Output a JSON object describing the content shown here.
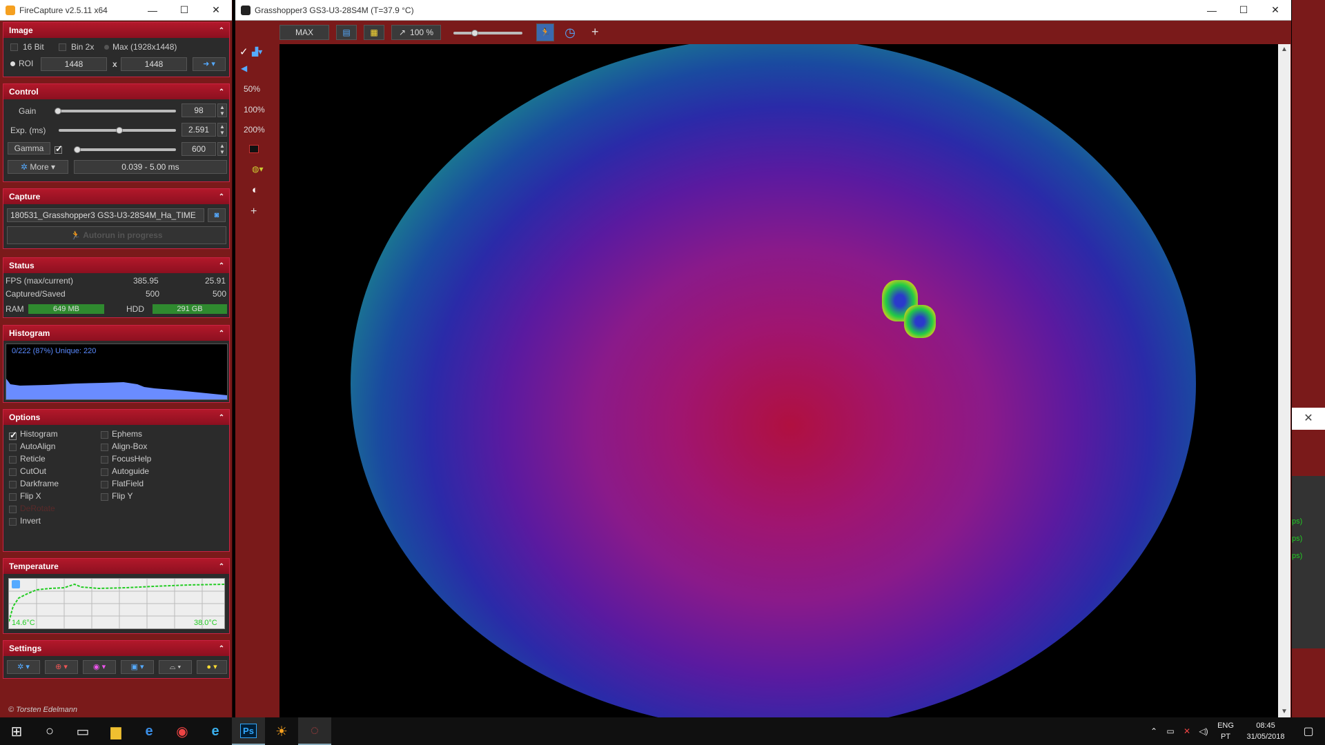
{
  "firecapture": {
    "title": "FireCapture v2.5.11  x64",
    "win_min": "—",
    "win_max": "☐",
    "win_close": "✕",
    "image": {
      "header": "Image",
      "bit16": "16 Bit",
      "bin2x": "Bin 2x",
      "max": "Max (1928x1448)",
      "roi_label": "ROI",
      "roi_w": "1448",
      "x_sep": "x",
      "roi_h": "1448"
    },
    "control": {
      "header": "Control",
      "gain_label": "Gain",
      "gain_value": "98",
      "gain_level": 0.0,
      "exp_label": "Exp. (ms)",
      "exp_value": "2.591",
      "exp_level": 0.52,
      "gamma_label": "Gamma",
      "gamma_value": "600",
      "gamma_level": 0.0,
      "more_label": "More",
      "exp_range": "0.039 - 5.00 ms"
    },
    "capture": {
      "header": "Capture",
      "filename": "180531_Grasshopper3 GS3-U3-28S4M_Ha_TIME",
      "progress_label": "Autorun in progress"
    },
    "status": {
      "header": "Status",
      "fps_label": "FPS (max/current)",
      "fps_max": "385.95",
      "fps_cur": "25.91",
      "cap_label": "Captured/Saved",
      "captured": "500",
      "saved": "500",
      "ram_label": "RAM",
      "ram_value": "649 MB",
      "hdd_label": "HDD",
      "hdd_value": "291 GB"
    },
    "histogram": {
      "header": "Histogram",
      "info": "0/222 (87%)  Unique: 220"
    },
    "options": {
      "header": "Options",
      "left": [
        {
          "label": "Histogram",
          "checked": true
        },
        {
          "label": "AutoAlign",
          "checked": false
        },
        {
          "label": "Reticle",
          "checked": false
        },
        {
          "label": "CutOut",
          "checked": false
        },
        {
          "label": "Darkframe",
          "checked": false
        },
        {
          "label": "Flip X",
          "checked": false
        },
        {
          "label": "DeRotate",
          "checked": false
        },
        {
          "label": "Invert",
          "checked": false
        }
      ],
      "right": [
        {
          "label": "Ephems",
          "checked": false
        },
        {
          "label": "Align-Box",
          "checked": false
        },
        {
          "label": "FocusHelp",
          "checked": false
        },
        {
          "label": "Autoguide",
          "checked": false
        },
        {
          "label": "FlatField",
          "checked": false
        },
        {
          "label": "Flip Y",
          "checked": false
        }
      ]
    },
    "temperature": {
      "header": "Temperature",
      "min_label": "14.6°C",
      "max_label": "38.0°C"
    },
    "settings": {
      "header": "Settings"
    },
    "copyright": "© Torsten Edelmann"
  },
  "camera": {
    "title": "Grasshopper3 GS3-U3-28S4M (T=37.9 °C)",
    "tb_max": "MAX",
    "zoom": "100 %",
    "z50": "50%",
    "z100": "100%",
    "z200": "200%",
    "plus": "+"
  },
  "side_labels": [
    "ps)",
    "ps)",
    "ps)"
  ],
  "taskbar": {
    "lang1": "ENG",
    "lang2": "PT",
    "time": "08:45",
    "date": "31/05/2018"
  }
}
